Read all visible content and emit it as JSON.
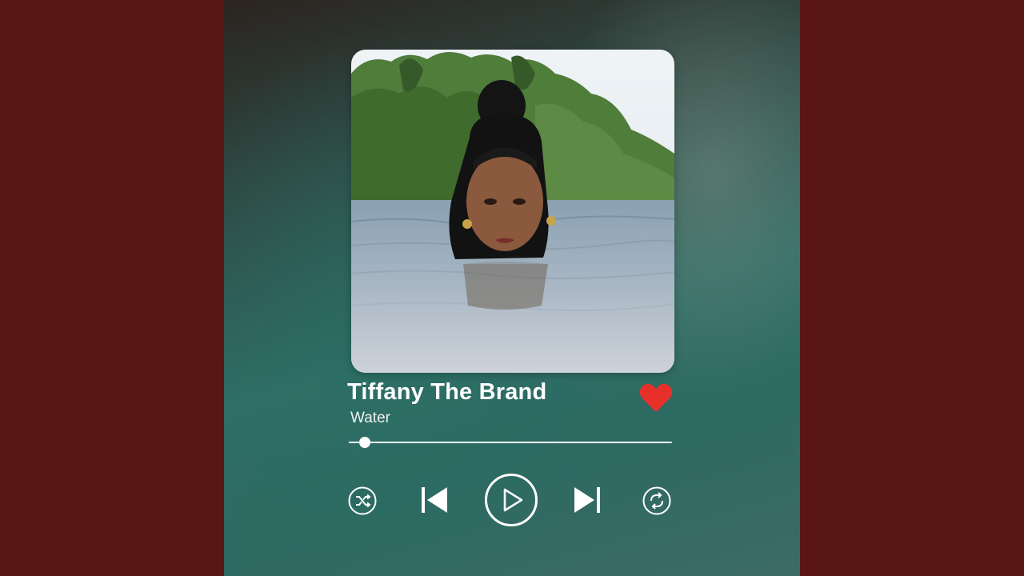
{
  "now_playing": {
    "artist": "Tiffany The Brand",
    "track": "Water",
    "liked": true,
    "progress_fraction": 0.05
  },
  "colors": {
    "heart": "#e8302b",
    "controls": "#ffffff",
    "side_panels": "#5a1515"
  },
  "icons": {
    "like": "heart-icon",
    "shuffle": "shuffle-icon",
    "previous": "skip-previous-icon",
    "play": "play-icon",
    "next": "skip-next-icon",
    "repeat": "repeat-icon"
  }
}
